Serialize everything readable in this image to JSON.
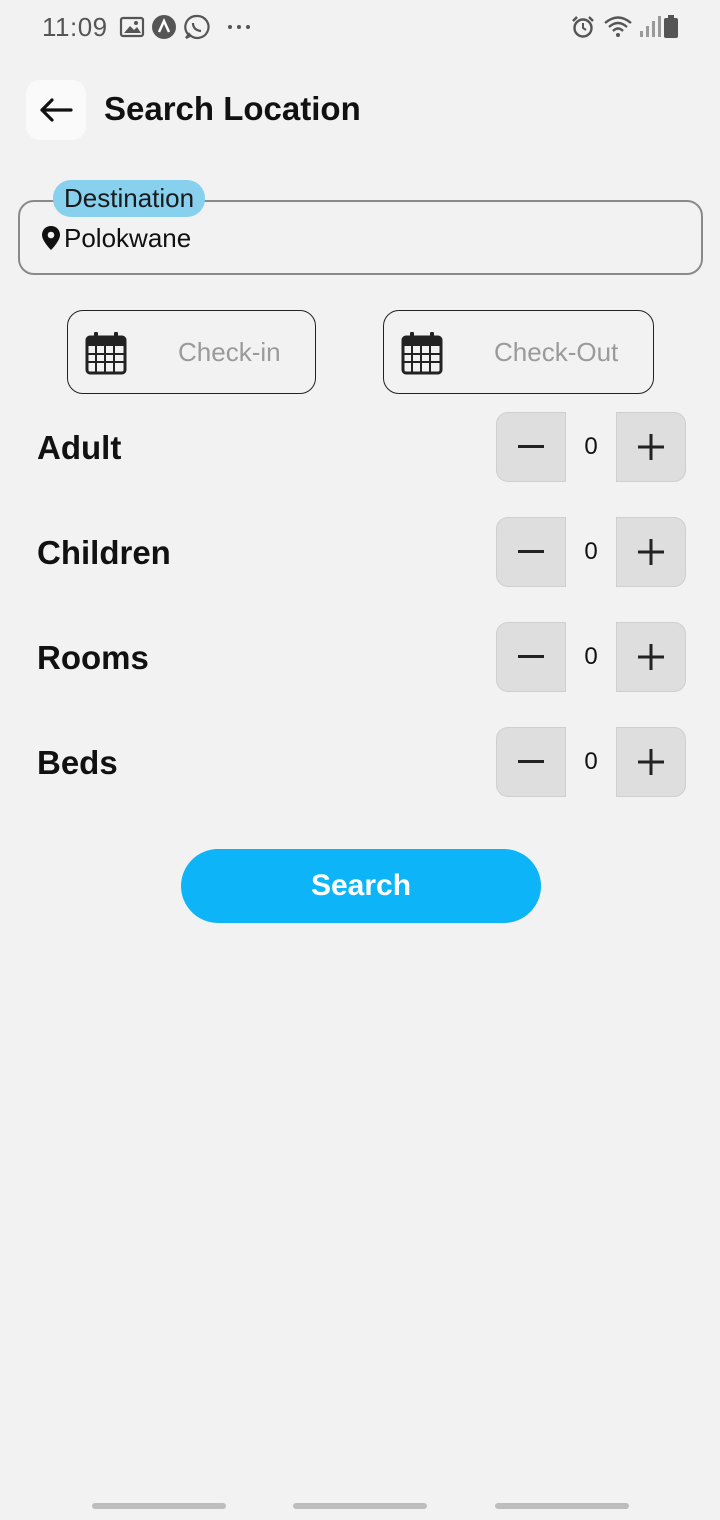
{
  "status_bar": {
    "time": "11:09",
    "left_icons": [
      "gallery-icon",
      "app-a-icon",
      "whatsapp-icon",
      "more-dots-icon"
    ],
    "right_icons": [
      "alarm-icon",
      "wifi-icon",
      "signal-icon",
      "battery-icon"
    ]
  },
  "header": {
    "title": "Search Location",
    "back_icon": "arrow-left-icon"
  },
  "destination": {
    "label": "Destination",
    "value": "Polokwane",
    "icon": "location-pin-icon"
  },
  "dates": {
    "check_in_placeholder": "Check-in",
    "check_out_placeholder": "Check-Out",
    "icon": "calendar-icon"
  },
  "counters": [
    {
      "label": "Adult",
      "value": "0"
    },
    {
      "label": "Children",
      "value": "0"
    },
    {
      "label": "Rooms",
      "value": "0"
    },
    {
      "label": "Beds",
      "value": "0"
    }
  ],
  "search_button": {
    "label": "Search"
  },
  "colors": {
    "accent": "#0db4f7",
    "destination_chip": "#87d0ee",
    "background": "#f2f2f2"
  }
}
